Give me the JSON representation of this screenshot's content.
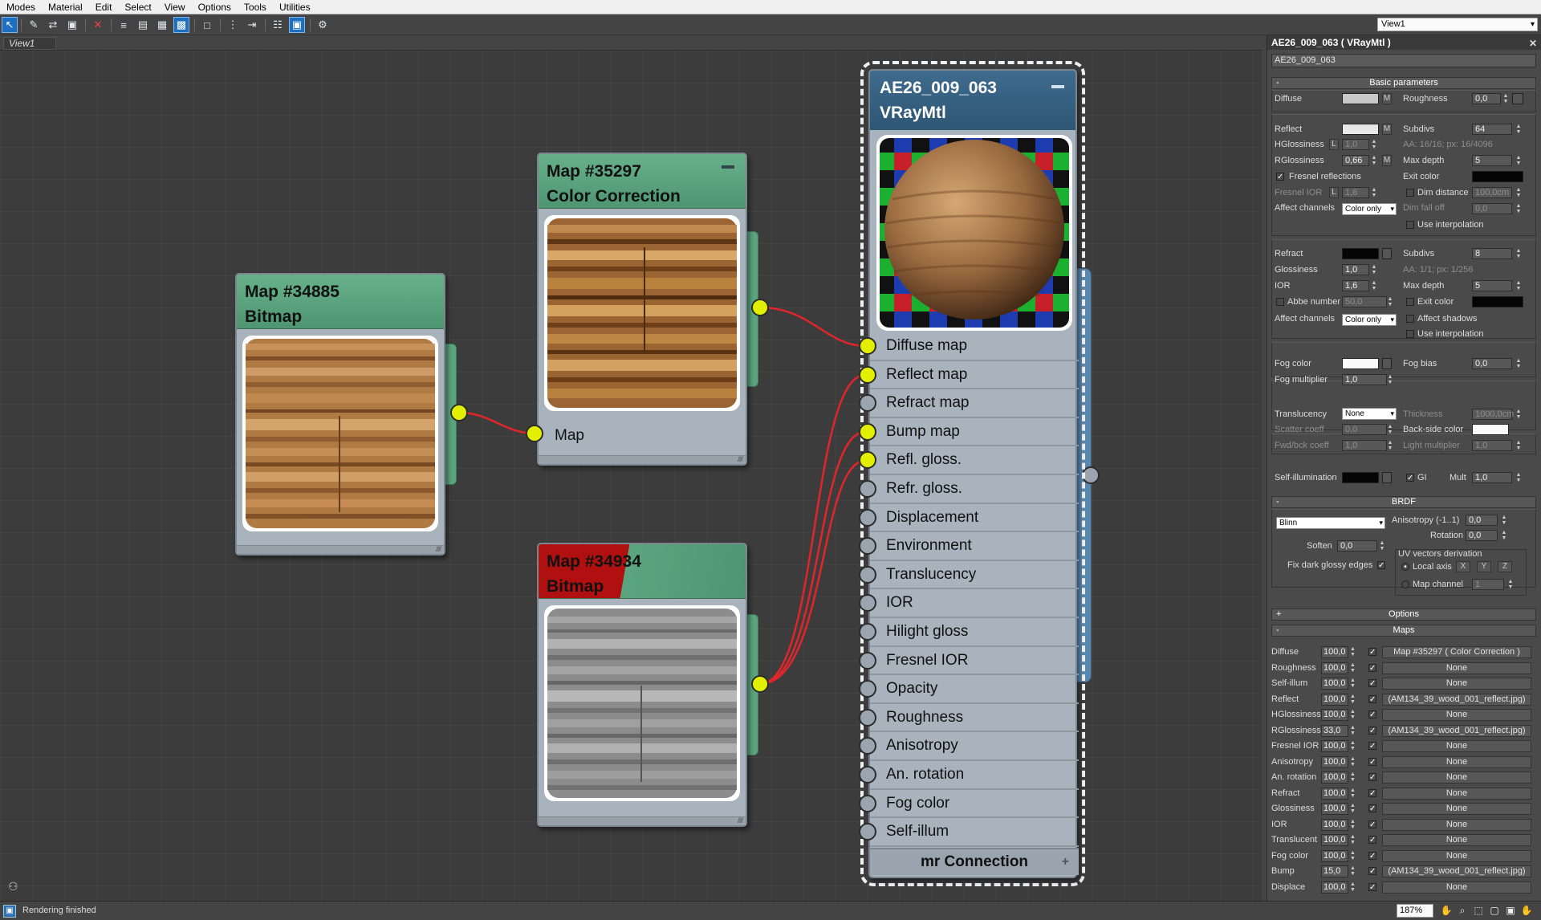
{
  "menu": [
    "Modes",
    "Material",
    "Edit",
    "Select",
    "View",
    "Options",
    "Tools",
    "Utilities"
  ],
  "toolbar": {
    "view_select": "View1",
    "icons": [
      "select-icon",
      "eyedropper-icon",
      "put-material-icon",
      "assign-material-icon",
      "delete-icon",
      "move-children-icon",
      "hide-unused-icon",
      "checker-background-icon",
      "show-map-icon",
      "layout-icon",
      "layout-children-icon",
      "lay-out-all-icon",
      "show-shaded-icon",
      "nav-icon"
    ]
  },
  "view_tab": "View1",
  "nodes": {
    "bitmap1": {
      "name": "Map #34885",
      "type": "Bitmap"
    },
    "color_correction": {
      "name": "Map #35297",
      "type": "Color Correction",
      "input_slot": "Map"
    },
    "bitmap2": {
      "name": "Map #34934",
      "type": "Bitmap",
      "error": true
    },
    "vray": {
      "name": "AE26_009_063",
      "type": "VRayMtl",
      "slots": [
        {
          "label": "Diffuse map",
          "connected": true
        },
        {
          "label": "Reflect map",
          "connected": true
        },
        {
          "label": "Refract map",
          "connected": false
        },
        {
          "label": "Bump map",
          "connected": true
        },
        {
          "label": "Refl. gloss.",
          "connected": true
        },
        {
          "label": "Refr. gloss.",
          "connected": false
        },
        {
          "label": "Displacement",
          "connected": false
        },
        {
          "label": "Environment",
          "connected": false
        },
        {
          "label": "Translucency",
          "connected": false
        },
        {
          "label": "IOR",
          "connected": false
        },
        {
          "label": "Hilight gloss",
          "connected": false
        },
        {
          "label": "Fresnel IOR",
          "connected": false
        },
        {
          "label": "Opacity",
          "connected": false
        },
        {
          "label": "Roughness",
          "connected": false
        },
        {
          "label": "Anisotropy",
          "connected": false
        },
        {
          "label": "An. rotation",
          "connected": false
        },
        {
          "label": "Fog color",
          "connected": false
        },
        {
          "label": "Self-illum",
          "connected": false
        }
      ],
      "footer": "mr Connection"
    }
  },
  "panel": {
    "title": "AE26_009_063  ( VRayMtl )",
    "name_field": "AE26_009_063",
    "basic": {
      "header": "Basic parameters",
      "diffuse": "Diffuse",
      "roughness": "Roughness",
      "roughness_val": "0,0",
      "reflect": "Reflect",
      "subdivs": "Subdivs",
      "subdivs_val": "64",
      "hglossiness": "HGlossiness",
      "hglossiness_val": "1,0",
      "aa": "AA: 16/16; px: 16/4096",
      "rglossiness": "RGlossiness",
      "rglossiness_val": "0,66",
      "max_depth": "Max depth",
      "max_depth_val": "5",
      "fresnel": "Fresnel reflections",
      "exit_color": "Exit color",
      "fresnel_ior": "Fresnel IOR",
      "fresnel_ior_val": "1,6",
      "dim_distance": "Dim distance",
      "dim_distance_val": "100,0cm",
      "affect_channels": "Affect channels",
      "affect_channels_val": "Color only",
      "dim_falloff": "Dim fall off",
      "dim_falloff_val": "0,0",
      "use_interp": "Use interpolation",
      "refract": "Refract",
      "r_subdivs_val": "8",
      "glossiness": "Glossiness",
      "glossiness_val": "1,0",
      "r_aa": "AA: 1/1; px: 1/256",
      "ior": "IOR",
      "ior_val": "1,6",
      "r_max_depth_val": "5",
      "abbe": "Abbe number",
      "abbe_val": "50,0",
      "exit_color2": "Exit color",
      "affect_channels2_val": "Color only",
      "affect_shadows": "Affect shadows",
      "use_interp2": "Use interpolation",
      "fog_color": "Fog color",
      "fog_bias": "Fog bias",
      "fog_bias_val": "0,0",
      "fog_mult": "Fog multiplier",
      "fog_mult_val": "1,0",
      "translucency": "Translucency",
      "translucency_val": "None",
      "thickness": "Thickness",
      "thickness_val": "1000,0cm",
      "scatter": "Scatter coeff",
      "scatter_val": "0,0",
      "backside": "Back-side color",
      "fwdbck": "Fwd/bck coeff",
      "fwdbck_val": "1,0",
      "light_mult": "Light multiplier",
      "light_mult_val": "1,0",
      "self_illum": "Self-illumination",
      "gi": "GI",
      "mult": "Mult",
      "mult_val": "1,0"
    },
    "brdf": {
      "header": "BRDF",
      "type_val": "Blinn",
      "anisotropy": "Anisotropy (-1..1)",
      "anisotropy_val": "0,0",
      "rotation": "Rotation",
      "rotation_val": "0,0",
      "soften": "Soften",
      "soften_val": "0,0",
      "uv_derivation": "UV vectors derivation",
      "fix_dark": "Fix dark glossy edges",
      "local_axis": "Local axis",
      "x": "X",
      "y": "Y",
      "z": "Z",
      "map_channel": "Map channel",
      "map_channel_val": "1"
    },
    "options_header": "Options",
    "maps_header": "Maps",
    "maps": [
      {
        "name": "Diffuse",
        "amount": "100,0",
        "map": "Map #35297  ( Color Correction )"
      },
      {
        "name": "Roughness",
        "amount": "100,0",
        "map": "None"
      },
      {
        "name": "Self-illum",
        "amount": "100,0",
        "map": "None"
      },
      {
        "name": "Reflect",
        "amount": "100,0",
        "map": "(AM134_39_wood_001_reflect.jpg)"
      },
      {
        "name": "HGlossiness",
        "amount": "100,0",
        "map": "None"
      },
      {
        "name": "RGlossiness",
        "amount": "33,0",
        "map": "(AM134_39_wood_001_reflect.jpg)"
      },
      {
        "name": "Fresnel IOR",
        "amount": "100,0",
        "map": "None"
      },
      {
        "name": "Anisotropy",
        "amount": "100,0",
        "map": "None"
      },
      {
        "name": "An. rotation",
        "amount": "100,0",
        "map": "None"
      },
      {
        "name": "Refract",
        "amount": "100,0",
        "map": "None"
      },
      {
        "name": "Glossiness",
        "amount": "100,0",
        "map": "None"
      },
      {
        "name": "IOR",
        "amount": "100,0",
        "map": "None"
      },
      {
        "name": "Translucent",
        "amount": "100,0",
        "map": "None"
      },
      {
        "name": "Fog color",
        "amount": "100,0",
        "map": "None"
      },
      {
        "name": "Bump",
        "amount": "15,0",
        "map": "(AM134_39_wood_001_reflect.jpg)"
      },
      {
        "name": "Displace",
        "amount": "100,0",
        "map": "None"
      }
    ]
  },
  "status": {
    "text": "Rendering finished",
    "zoom": "187%"
  },
  "colors": {
    "wire": "#e0262b",
    "port_on": "#e2f000",
    "node_green": "#5aa57f",
    "node_blue": "#3e6b8e",
    "error_red": "#b0100f"
  }
}
